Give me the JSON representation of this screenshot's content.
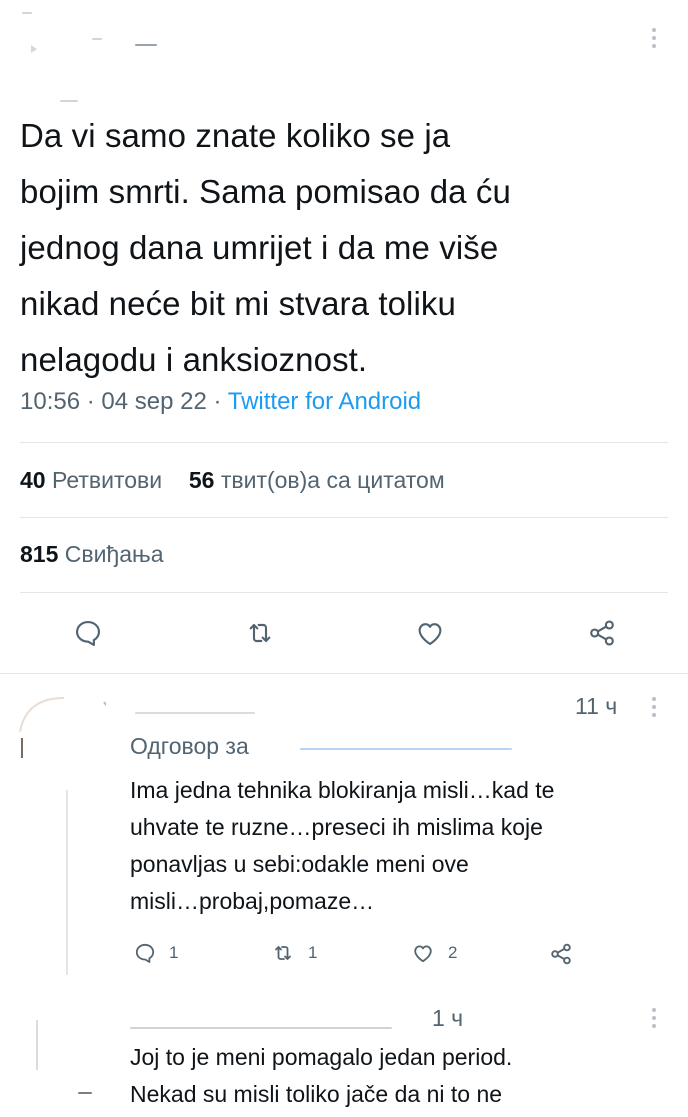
{
  "tweet": {
    "text_lines": [
      "Da vi samo znate koliko se ja",
      "bojim smrti. Sama pomisao da ću",
      "jednog dana umrijet i da me više",
      "nikad neće bit mi stvara toliku",
      "nelagodu i anksioznost."
    ],
    "time": "10:56",
    "date": "04 sep 22",
    "source": "Twitter for Android",
    "retweets_count": "40",
    "retweets_label": "Ретвитови",
    "quotes_count": "56",
    "quotes_label": "твит(ов)а са цитатом",
    "likes_count": "815",
    "likes_label": "Свиђања"
  },
  "actions": {
    "icons": [
      "reply-icon",
      "retweet-icon",
      "like-icon",
      "share-icon"
    ]
  },
  "replies": [
    {
      "age": "11 ч",
      "reply_to_label": "Одговор за",
      "text_lines": [
        "Ima jedna tehnika blokiranja misli…kad te",
        "uhvate te ruzne…preseci ih mislima koje",
        "ponavljas u sebi:odakle meni ove",
        "misli…probaj,pomaze…"
      ],
      "reply_count": "1",
      "retweet_count": "1",
      "like_count": "2"
    },
    {
      "age": "1 ч",
      "text_lines": [
        "Joj to je meni pomagalo jedan period.",
        "Nekad su misli toliko jače da ni to ne"
      ]
    }
  ],
  "colors": {
    "text": "#0f1419",
    "muted": "#536471",
    "accent": "#1d9bf0",
    "divider": "#e3e6e8"
  }
}
